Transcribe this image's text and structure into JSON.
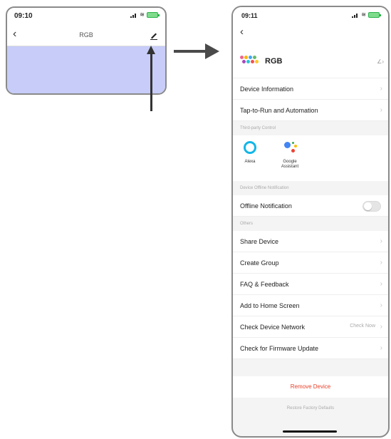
{
  "left_screen": {
    "time": "09:10",
    "title": "RGB",
    "back_icon": "chevron-left-icon",
    "edit_icon": "pencil-icon",
    "content_color": "#c7cdf8"
  },
  "right_screen": {
    "time": "09:11",
    "back_icon": "chevron-left-icon",
    "device": {
      "name": "RGB",
      "logo_icon": "rgb-dots-icon",
      "edit_icon": "pencil-icon"
    },
    "rows_top": [
      {
        "label": "Device Information"
      },
      {
        "label": "Tap-to-Run and Automation"
      }
    ],
    "third_party_header": "Third-party Control",
    "services": [
      {
        "name": "Alexa",
        "icon": "alexa-icon"
      },
      {
        "name": "Google Assistant",
        "icon": "google-assistant-icon"
      }
    ],
    "offline_header": "Device Offline Notification",
    "offline_row": {
      "label": "Offline Notification",
      "toggle_on": false
    },
    "others_header": "Others",
    "rows_others": [
      {
        "label": "Share Device",
        "value": ""
      },
      {
        "label": "Create Group",
        "value": ""
      },
      {
        "label": "FAQ & Feedback",
        "value": ""
      },
      {
        "label": "Add to Home Screen",
        "value": ""
      },
      {
        "label": "Check Device Network",
        "value": "Check Now"
      },
      {
        "label": "Check for Firmware Update",
        "value": ""
      }
    ],
    "remove_label": "Remove Device",
    "restore_label": "Restore Factory Defaults"
  },
  "colors": {
    "remove": "#e8412b",
    "alexa": "#12b6e8",
    "battery": "#7fdc8c"
  }
}
